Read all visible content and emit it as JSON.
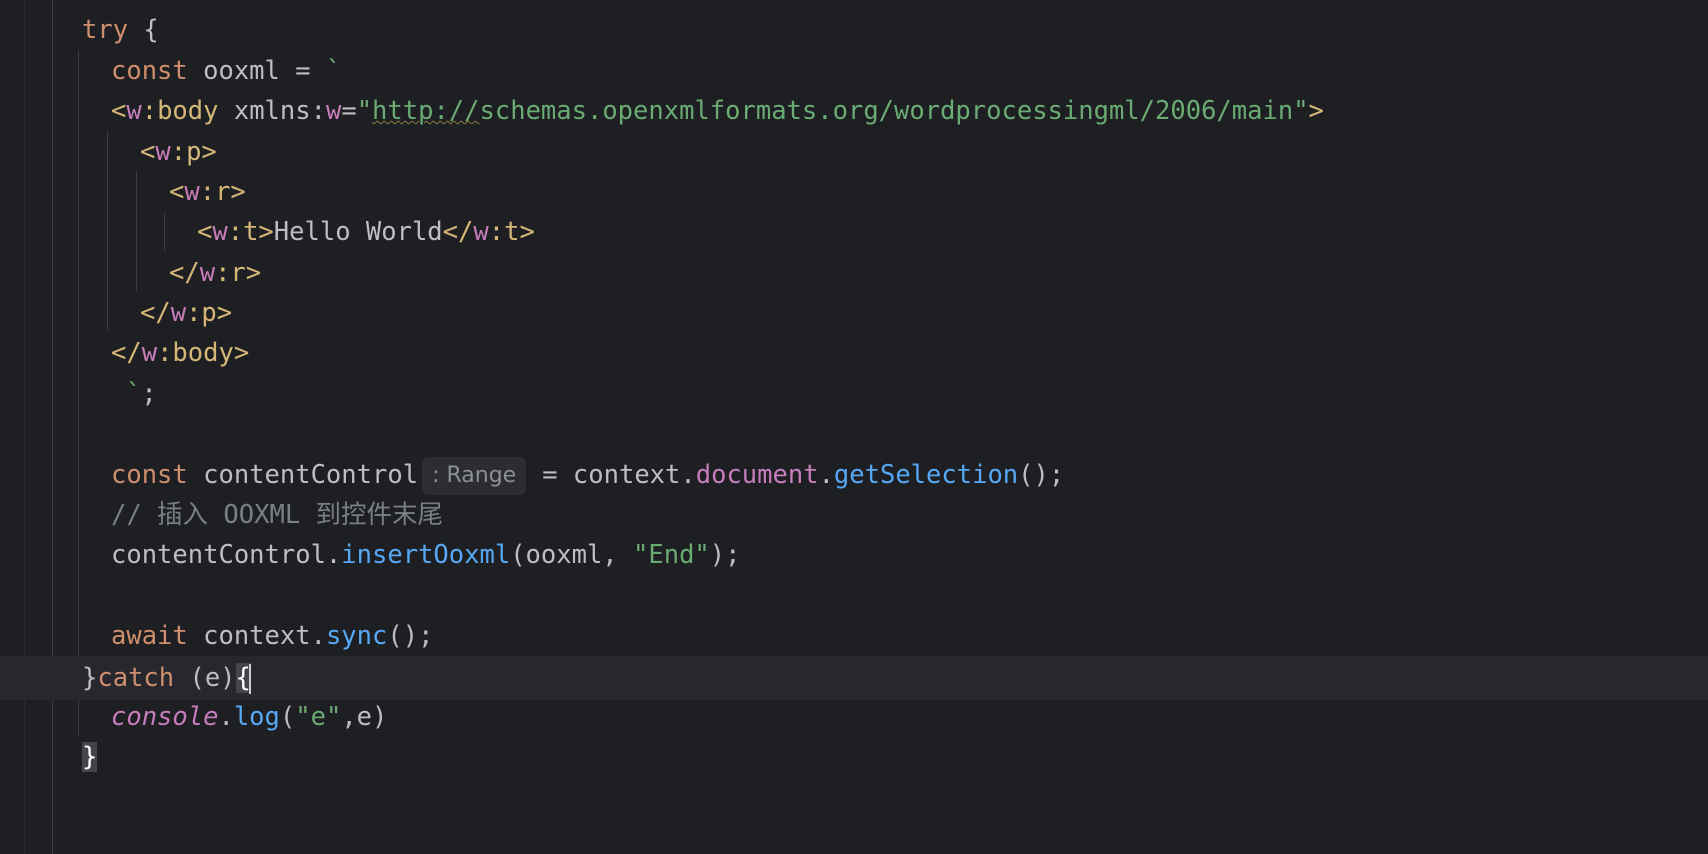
{
  "lines": [
    {
      "try_kw": "try",
      "brace": " {"
    },
    {
      "kw": "const",
      "name": " ooxml",
      "op": " = ",
      "tick": "`"
    },
    {
      "open": "<",
      "ns": "w",
      "colon": ":",
      "tagname": "body",
      "attr": " xmlns:",
      "attr_ns": "w",
      "eq": "=",
      "q1": "\"",
      "url": "http://",
      "rest": "schemas.openxmlformats.org/wordprocessingml/2006/main",
      "q2": "\"",
      "close": ">"
    },
    {
      "open": "<",
      "ns": "w",
      "rest": ":p>"
    },
    {
      "open": "<",
      "ns": "w",
      "rest": ":r>"
    },
    {
      "open": "<",
      "ns": "w",
      "mid": ":t>",
      "text": "Hello World",
      "close_open": "</",
      "ns2": "w",
      "close_rest": ":t>"
    },
    {
      "open": "</",
      "ns": "w",
      "rest": ":r>"
    },
    {
      "open": "</",
      "ns": "w",
      "rest": ":p>"
    },
    {
      "open": "</",
      "ns": "w",
      "rest": ":body>"
    },
    {
      "tick": "`",
      "semi": ";"
    },
    {
      "kw": "const",
      "name": " contentControl",
      "hint": ": Range",
      "op": "= context.",
      "prop": "document",
      "dot": ".",
      "fn": "getSelection",
      "tail": "();"
    },
    {
      "comment": "// 插入 OOXML 到控件末尾"
    },
    {
      "obj": "contentControl.",
      "fn": "insertOoxml",
      "args1": "(ooxml, ",
      "str": "\"End\"",
      "tail": ");"
    },
    {
      "kw": "await",
      "rest": " context.",
      "fn": "sync",
      "tail": "();"
    },
    {
      "close": "}",
      "kw": "catch",
      "args": " (e)",
      "brace": "{"
    },
    {
      "obj": "console",
      "dot": ".",
      "fn": "log",
      "p1": "(",
      "str": "\"e\"",
      "tail": ",e)"
    },
    {
      "brace": "}"
    }
  ]
}
